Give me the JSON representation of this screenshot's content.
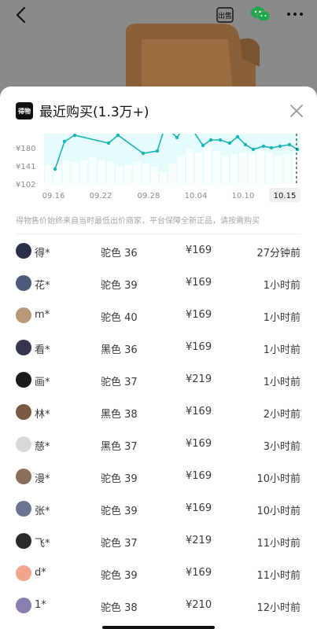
{
  "topbar": {
    "back_icon": "chevron-left-icon",
    "sell_label": "出售",
    "wechat_icon": "wechat-icon",
    "more_icon": "more-dots-icon"
  },
  "sheet": {
    "logo_text": "得物",
    "title": "最近购买(1.3万+)",
    "close_icon": "close-icon",
    "notice": "得物售价始终来自当时最低出价商家，平台保障全新正品，请按需购买"
  },
  "colors": {
    "accent_line": "#19b4b4",
    "bar_fill": "#eef0f6",
    "area_fill": "#e6fbfb"
  },
  "chart_data": {
    "type": "line",
    "y_ticks": [
      "¥180",
      "¥141",
      "¥102"
    ],
    "x_ticks": [
      "09.16",
      "09.22",
      "09.28",
      "10.04",
      "10.10",
      "10.15"
    ],
    "selected_x": "10.15",
    "ylim": [
      102,
      219
    ]
  },
  "purchases": [
    {
      "user": "得*",
      "spec": "驼色 36",
      "price": "¥169",
      "time": "27分钟前",
      "avatar_color": "#2b2f4a"
    },
    {
      "user": "花*",
      "spec": "驼色 39",
      "price": "¥169",
      "time": "1小时前",
      "avatar_color": "#4d5a7a"
    },
    {
      "user": "m*",
      "spec": "驼色 40",
      "price": "¥169",
      "time": "1小时前",
      "avatar_color": "#b89a78"
    },
    {
      "user": "看*",
      "spec": "黑色 36",
      "price": "¥169",
      "time": "1小时前",
      "avatar_color": "#33364d"
    },
    {
      "user": "画*",
      "spec": "驼色 37",
      "price": "¥219",
      "time": "1小时前",
      "avatar_color": "#1a1a1a"
    },
    {
      "user": "林*",
      "spec": "黑色 38",
      "price": "¥169",
      "time": "2小时前",
      "avatar_color": "#7a5a44"
    },
    {
      "user": "慈*",
      "spec": "黑色 37",
      "price": "¥169",
      "time": "3小时前",
      "avatar_color": "#d9d9d9"
    },
    {
      "user": "漫*",
      "spec": "驼色 39",
      "price": "¥169",
      "time": "10小时前",
      "avatar_color": "#8a6e5c"
    },
    {
      "user": "张*",
      "spec": "驼色 39",
      "price": "¥169",
      "time": "10小时前",
      "avatar_color": "#6a7390"
    },
    {
      "user": "飞*",
      "spec": "驼色 37",
      "price": "¥219",
      "time": "11小时前",
      "avatar_color": "#2a2a2a"
    },
    {
      "user": "d*",
      "spec": "驼色 39",
      "price": "¥169",
      "time": "11小时前",
      "avatar_color": "#f0a58c"
    },
    {
      "user": "1*",
      "spec": "驼色 38",
      "price": "¥210",
      "time": "12小时前",
      "avatar_color": "#8c7fb0"
    }
  ]
}
